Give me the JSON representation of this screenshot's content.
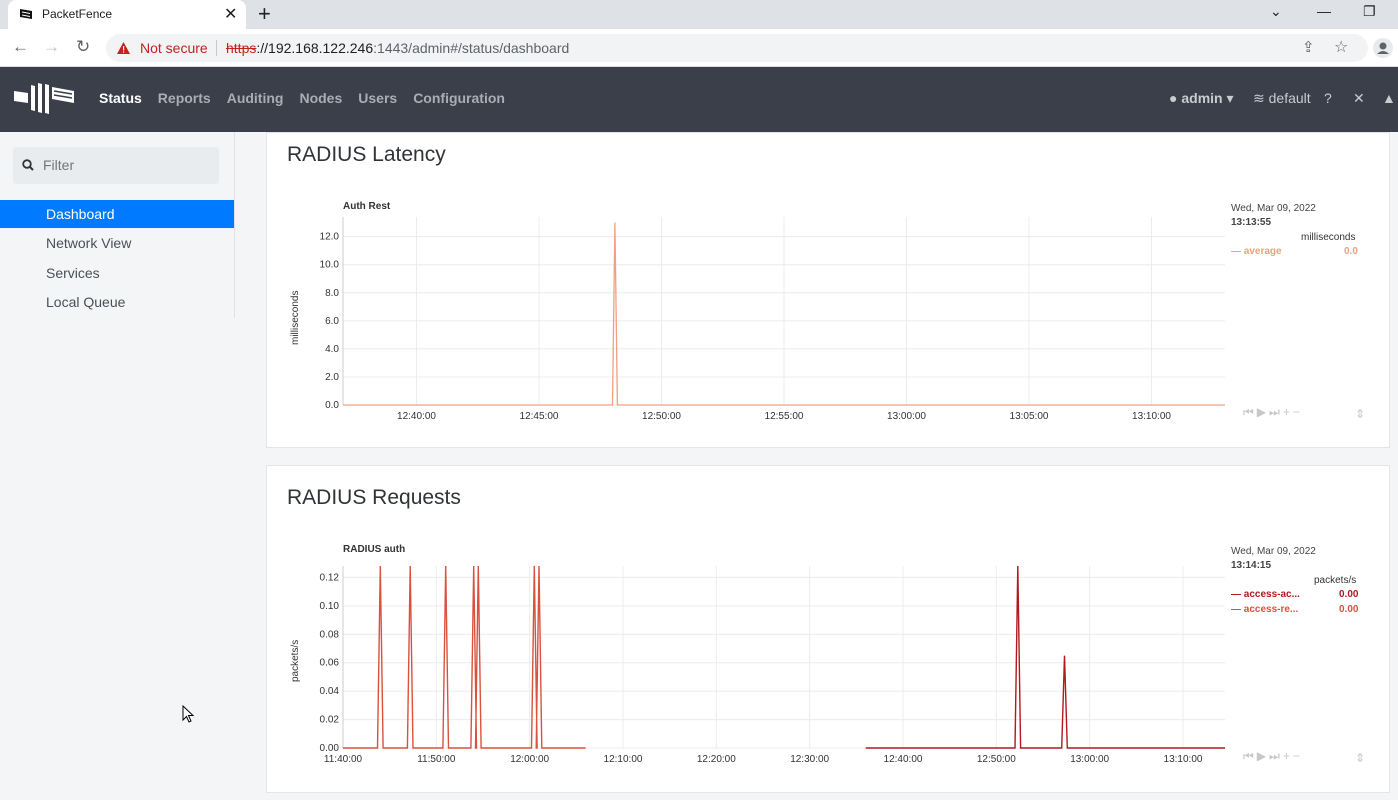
{
  "browser": {
    "tab_title": "PacketFence",
    "not_secure": "Not secure",
    "url_scheme": "https",
    "url_host": "://192.168.122.246",
    "url_rest": ":1443/admin#/status/dashboard"
  },
  "header": {
    "nav": [
      "Status",
      "Reports",
      "Auditing",
      "Nodes",
      "Users",
      "Configuration"
    ],
    "user": "admin",
    "tenant": "default"
  },
  "sidebar": {
    "filter_placeholder": "Filter",
    "items": [
      "Dashboard",
      "Network View",
      "Services",
      "Local Queue"
    ]
  },
  "latency": {
    "title": "RADIUS Latency",
    "chart_label": "Auth Rest",
    "legend_date": "Wed, Mar 09, 2022",
    "legend_time": "13:13:55",
    "legend_unit": "milliseconds",
    "legend_series": "average",
    "legend_value": "0.0",
    "color": "#f0a080"
  },
  "requests": {
    "title": "RADIUS Requests",
    "chart_label": "RADIUS auth",
    "legend_date": "Wed, Mar 09, 2022",
    "legend_time": "13:14:15",
    "legend_unit": "packets/s",
    "legend_series": [
      {
        "name": "access-ac...",
        "value": "0.00",
        "color": "#b0191e"
      },
      {
        "name": "access-re...",
        "value": "0.00",
        "color": "#d9523e"
      }
    ]
  },
  "chart_data": [
    {
      "type": "line",
      "title": "Auth Rest",
      "ylabel": "milliseconds",
      "yticks": [
        "0.0",
        "2.0",
        "4.0",
        "6.0",
        "8.0",
        "10.0",
        "12.0"
      ],
      "xticks": [
        "12:40:00",
        "12:45:00",
        "12:50:00",
        "12:55:00",
        "13:00:00",
        "13:05:00",
        "13:10:00"
      ],
      "ylim": [
        0,
        13.4
      ],
      "x_minutes": [
        0,
        11,
        11.1,
        11.2,
        36
      ],
      "x_start": "12:37:00",
      "series": [
        {
          "name": "average",
          "values": [
            0,
            0,
            13.0,
            0,
            0
          ]
        }
      ]
    },
    {
      "type": "line",
      "title": "RADIUS auth",
      "ylabel": "packets/s",
      "yticks": [
        "0.00",
        "0.02",
        "0.04",
        "0.06",
        "0.08",
        "0.10",
        "0.12"
      ],
      "xticks": [
        "11:40:00",
        "11:50:00",
        "12:00:00",
        "12:10:00",
        "12:20:00",
        "12:30:00",
        "12:40:00",
        "12:50:00",
        "13:00:00",
        "13:10:00"
      ],
      "ylim": [
        0,
        0.128
      ],
      "series": [
        {
          "name": "access-ac...",
          "peaks": [
            {
              "t": 72.3,
              "v": 0.128
            },
            {
              "t": 77.3,
              "v": 0.065
            }
          ]
        },
        {
          "name": "access-re...",
          "peaks": [
            {
              "t": 4,
              "v": 0.128
            },
            {
              "t": 7.2,
              "v": 0.128
            },
            {
              "t": 11,
              "v": 0.128
            },
            {
              "t": 14,
              "v": 0.128
            },
            {
              "t": 14.5,
              "v": 0.128
            },
            {
              "t": 20.5,
              "v": 0.128
            },
            {
              "t": 21,
              "v": 0.128
            }
          ]
        }
      ]
    }
  ]
}
